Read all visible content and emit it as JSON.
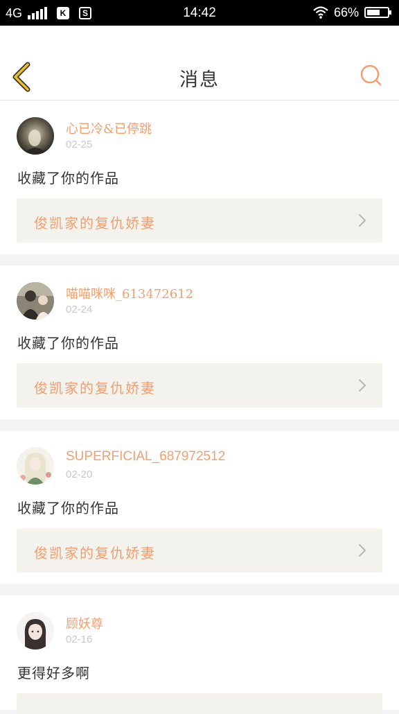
{
  "status_bar": {
    "network": "4G",
    "time": "14:42",
    "battery_percent": "66%",
    "battery_level": 0.66,
    "icons": [
      "signal-icon",
      "k-app-icon",
      "s-app-icon",
      "wifi-icon",
      "battery-icon"
    ],
    "k_label": "K",
    "s_label": "S"
  },
  "header": {
    "title": "消息",
    "back_icon": "chevron-left-icon",
    "search_icon": "search-icon"
  },
  "colors": {
    "accent": "#f0a070",
    "back_icon": "#f0c020",
    "work_box_bg": "#f3f2ec",
    "separator": "#f3f3f3"
  },
  "messages": [
    {
      "user": "心已冷&已停跳",
      "date": "02-25",
      "text": "收藏了你的作品",
      "work_title": "俊凯家的复仇娇妻"
    },
    {
      "user": "喵喵咪咪_613472612",
      "date": "02-24",
      "text": "收藏了你的作品",
      "work_title": "俊凯家的复仇娇妻"
    },
    {
      "user": "SUPERFICIAL_687972512",
      "date": "02-20",
      "text": "收藏了你的作品",
      "work_title": "俊凯家的复仇娇妻"
    },
    {
      "user": "顾妖尊",
      "date": "02-16",
      "text": "更得好多啊",
      "work_title": ""
    }
  ]
}
